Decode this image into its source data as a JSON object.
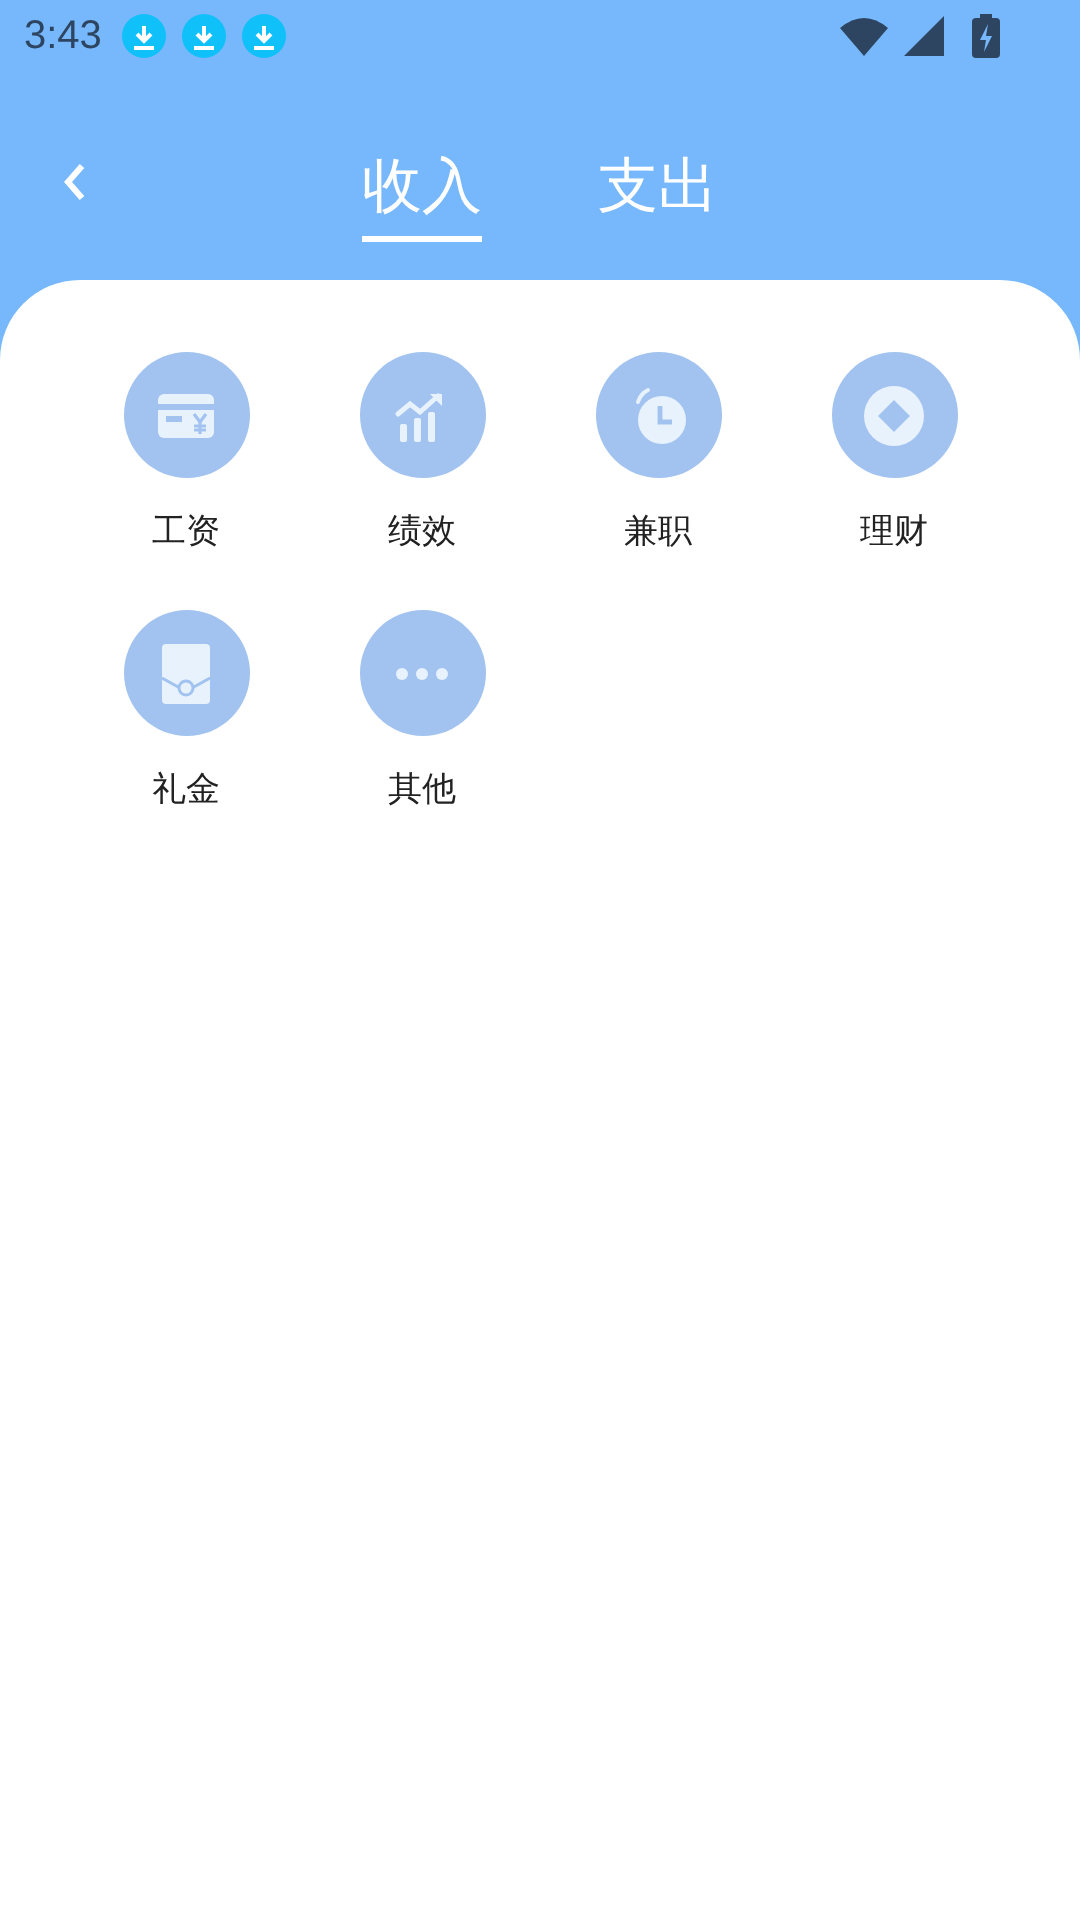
{
  "status_bar": {
    "time": "3:43",
    "notifications": [
      {
        "kind": "download"
      },
      {
        "kind": "download"
      },
      {
        "kind": "download"
      }
    ]
  },
  "tabs": [
    {
      "label": "收入",
      "selected": true
    },
    {
      "label": "支出",
      "selected": false
    }
  ],
  "categories": [
    {
      "label": "工资"
    },
    {
      "label": "绩效"
    },
    {
      "label": "兼职"
    },
    {
      "label": "理财"
    },
    {
      "label": "礼金"
    },
    {
      "label": "其他"
    }
  ]
}
